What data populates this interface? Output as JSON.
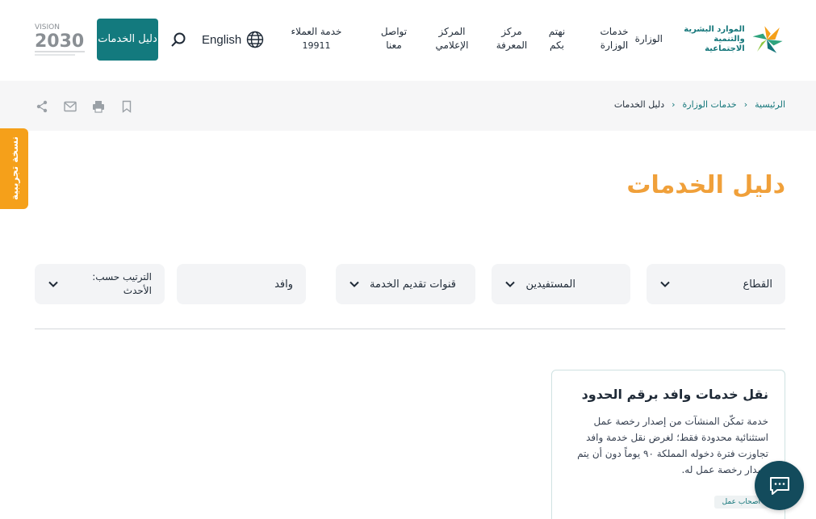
{
  "header": {
    "logo_text_line1": "الموارد البشرية",
    "logo_text_line2": "والتنمية الاجتماعية",
    "nav": {
      "ministry": "الوزارة",
      "services": "خدمات الوزارة",
      "we_care": "نهتم بكم",
      "knowledge_center": "مركز المعرفة",
      "media_center": "المركز الإعلامي",
      "contact": "تواصل معنا",
      "customer_service": "خدمة العملاء",
      "customer_service_number": "19911"
    },
    "language": "English",
    "guide_button": "دليل الخدمات",
    "vision_text": "VISION 2030"
  },
  "breadcrumb": {
    "home": "الرئيسية",
    "services": "خدمات الوزارة",
    "current": "دليل الخدمات"
  },
  "beta_tab": "نسخة تجريبية",
  "page_title": "دليل الخدمات",
  "filters": {
    "sector": "القطاع",
    "beneficiaries": "المستفيدين",
    "channels": "قنوات تقديم الخدمة",
    "search_value": "وافد",
    "sort": "الترتيب حسب: الأحدث"
  },
  "card": {
    "title": "نقل خدمات وافد برقم الحدود",
    "description": "خدمة تمكّن المنشآت من إصدار رخصة عمل استثنائية محدودة فقط؛ لغرض نقل خدمة وافد تجاوزت فترة دخوله المملكة ٩٠ يوماً دون أن يتم إصدار رخصة عمل له.",
    "tag": "أصحاب عمل"
  },
  "colors": {
    "primary": "#137a7e",
    "accent": "#f0a03a",
    "beta": "#f5a01a",
    "chat": "#134b5c"
  }
}
